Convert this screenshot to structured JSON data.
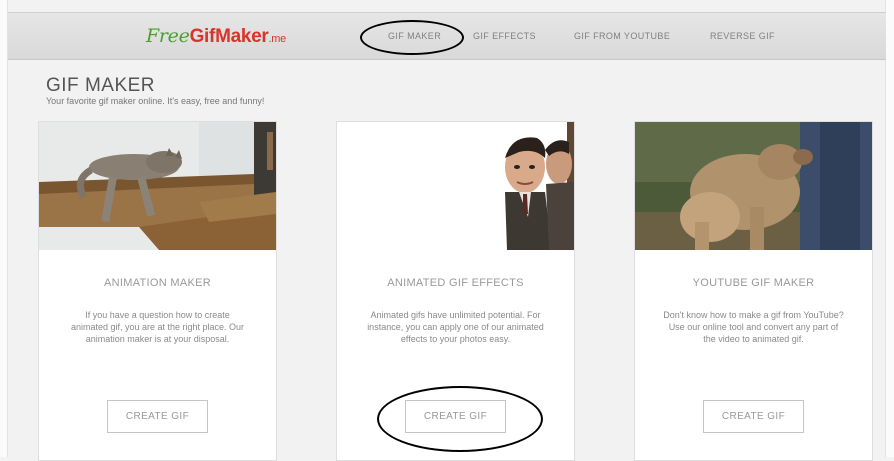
{
  "header": {
    "logo": {
      "free": "Free",
      "gif": "Gif",
      "maker": "Maker",
      "tld": ".me"
    },
    "nav": [
      {
        "label": "GIF MAKER"
      },
      {
        "label": "GIF EFFECTS"
      },
      {
        "label": "GIF FROM YOUTUBE"
      },
      {
        "label": "REVERSE GIF"
      }
    ]
  },
  "page": {
    "title": "GIF MAKER",
    "subtitle": "Your favorite gif maker online. It's easy, free and funny!"
  },
  "cards": [
    {
      "title": "ANIMATION MAKER",
      "description": "If you have a question how to create animated gif, you are at the right place. Our animation maker is at your disposal.",
      "button": "CREATE GIF",
      "image": "sleeping-cat-on-wooden-shelf"
    },
    {
      "title": "ANIMATED GIF EFFECTS",
      "description": "Animated gifs have unlimited potential. For instance, you can apply one of our animated effects to your photos easy.",
      "button": "CREATE GIF",
      "image": "two-men-peeking-from-edge"
    },
    {
      "title": "YOUTUBE GIF MAKER",
      "description": "Don't know how to make a gif from YouTube? Use our online tool and convert any part of the video to animated gif.",
      "button": "CREATE GIF",
      "image": "dog-jumping-outdoors"
    }
  ],
  "colors": {
    "logo_green": "#4c9e2c",
    "logo_red": "#d9332b",
    "annotation": "#000000"
  }
}
